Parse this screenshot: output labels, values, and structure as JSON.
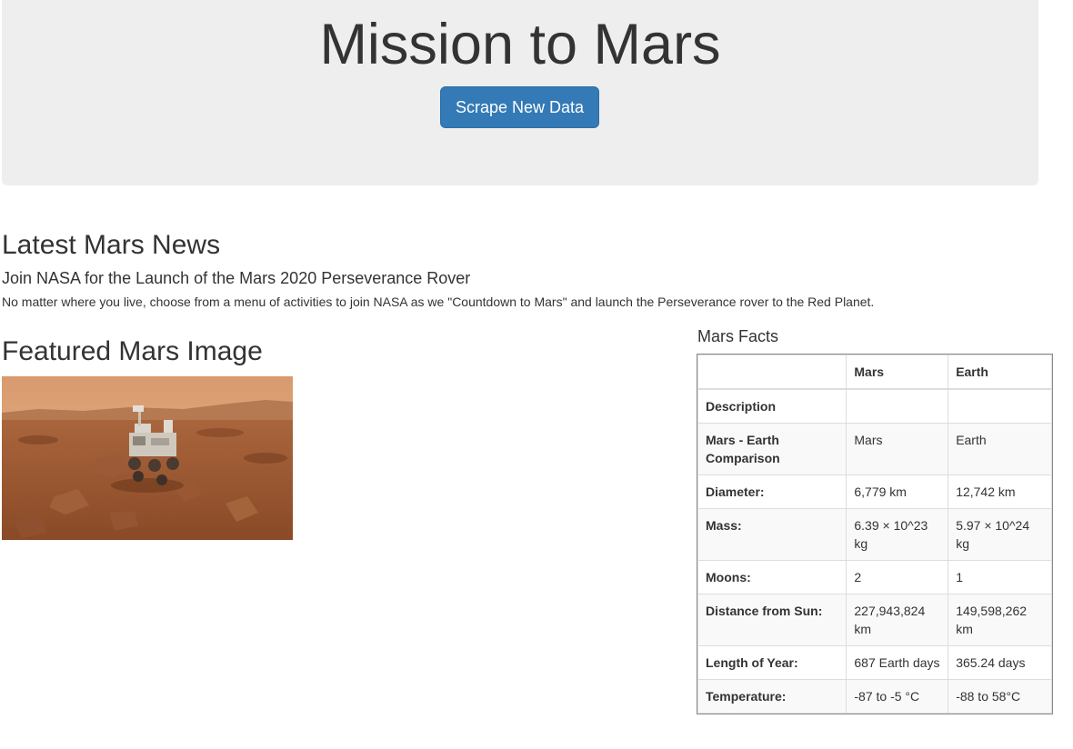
{
  "header": {
    "title": "Mission to Mars",
    "scrape_button_label": "Scrape New Data",
    "accent_color": "#337ab7"
  },
  "news": {
    "heading": "Latest Mars News",
    "title": "Join NASA for the Launch of the Mars 2020 Perseverance Rover",
    "paragraph": "No matter where you live, choose from a menu of activities to join NASA as we \"Countdown to Mars\" and launch the Perseverance rover to the Red Planet."
  },
  "featured": {
    "heading": "Featured Mars Image"
  },
  "facts": {
    "heading": "Mars Facts",
    "columns": [
      "",
      "Mars",
      "Earth"
    ],
    "rows": [
      {
        "label": "Description",
        "mars": "",
        "earth": ""
      },
      {
        "label": "Mars - Earth Comparison",
        "mars": "Mars",
        "earth": "Earth"
      },
      {
        "label": "Diameter:",
        "mars": "6,779 km",
        "earth": "12,742 km"
      },
      {
        "label": "Mass:",
        "mars": "6.39 × 10^23 kg",
        "earth": "5.97 × 10^24 kg"
      },
      {
        "label": "Moons:",
        "mars": "2",
        "earth": "1"
      },
      {
        "label": "Distance from Sun:",
        "mars": "227,943,824 km",
        "earth": "149,598,262 km"
      },
      {
        "label": "Length of Year:",
        "mars": "687 Earth days",
        "earth": "365.24 days"
      },
      {
        "label": "Temperature:",
        "mars": "-87 to -5 °C",
        "earth": "-88 to 58°C"
      }
    ]
  }
}
